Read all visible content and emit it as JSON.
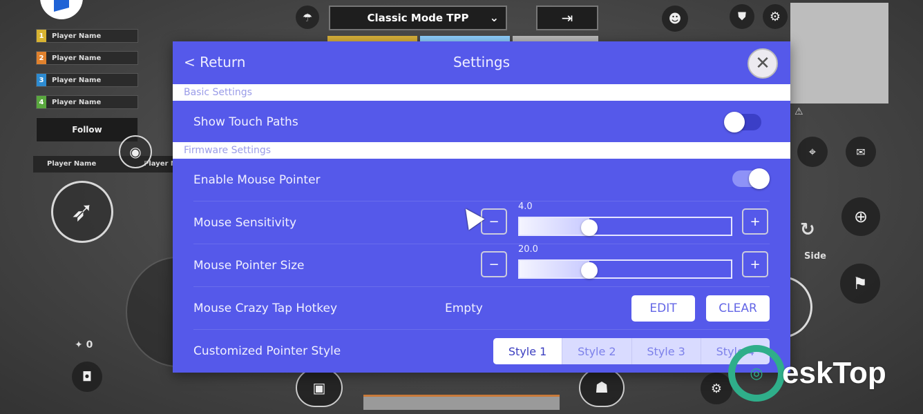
{
  "hud": {
    "players": [
      {
        "num": "1",
        "name": "Player Name",
        "color": "#d8b331"
      },
      {
        "num": "2",
        "name": "Player Name",
        "color": "#e0812d"
      },
      {
        "num": "3",
        "name": "Player Name",
        "color": "#2d8bd1"
      },
      {
        "num": "4",
        "name": "Player Name",
        "color": "#5aa83f"
      }
    ],
    "follow_label": "Follow",
    "spectate_name_1": "Player Name",
    "spectate_name_2": "Player N",
    "mode_label": "Classic Mode TPP",
    "side_label": "Side",
    "item_count": "0"
  },
  "settings": {
    "return_label": "< Return",
    "title": "Settings",
    "basic_section": "Basic Settings",
    "firmware_section": "Firmware Settings",
    "show_touch_paths": {
      "label": "Show Touch Paths",
      "on": false
    },
    "enable_mouse_pointer": {
      "label": "Enable Mouse Pointer",
      "on": true
    },
    "mouse_sensitivity": {
      "label": "Mouse Sensitivity",
      "value": "4.0",
      "minus": "−",
      "plus": "+",
      "fill_fraction": 0.33
    },
    "mouse_pointer_size": {
      "label": "Mouse Pointer Size",
      "value": "20.0",
      "minus": "−",
      "plus": "+",
      "fill_fraction": 0.33
    },
    "crazy_tap": {
      "label": "Mouse Crazy Tap Hotkey",
      "value": "Empty",
      "edit_label": "EDIT",
      "clear_label": "CLEAR"
    },
    "pointer_style": {
      "label": "Customized Pointer Style",
      "options": [
        "Style 1",
        "Style 2",
        "Style 3",
        "Style 4"
      ],
      "selected": 0
    }
  },
  "watermark": {
    "text": "eskTop"
  }
}
